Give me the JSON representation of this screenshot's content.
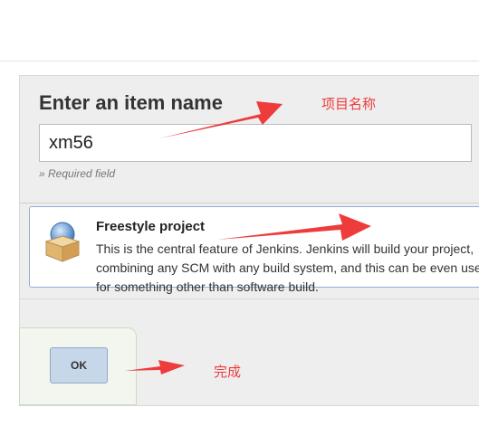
{
  "form": {
    "heading": "Enter an item name",
    "item_name_value": "xm56",
    "required_note": "» Required field"
  },
  "project_type": {
    "title": "Freestyle project",
    "description": "This is the central feature of Jenkins. Jenkins will build your project, combining any SCM with any build system, and this can be even used for something other than software build.",
    "icon": "freestyle-package-icon"
  },
  "actions": {
    "ok_label": "OK"
  },
  "annotations": {
    "item_name": "项目名称",
    "done": "完成",
    "color": "#ee3b3b"
  }
}
